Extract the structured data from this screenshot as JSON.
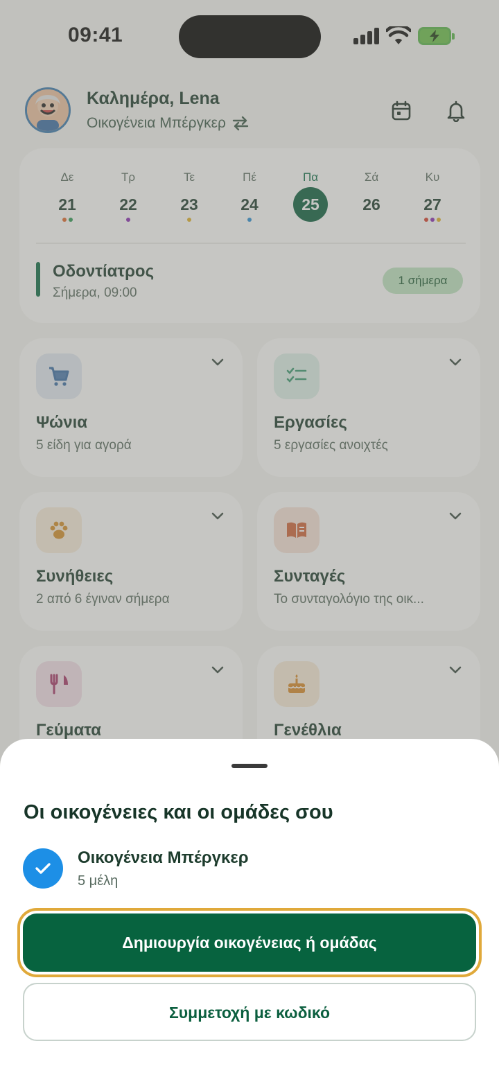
{
  "status_bar": {
    "time": "09:41"
  },
  "header": {
    "greeting": "Καλημέρα, Lena",
    "family": "Οικογένεια Μπέργκερ",
    "icons": [
      "avatar",
      "swap-icon",
      "calendar-icon",
      "bell-icon"
    ]
  },
  "calendar": {
    "days": [
      {
        "name": "Δε",
        "date": "21",
        "dots": [
          "#e06a2e",
          "#2e9a55"
        ]
      },
      {
        "name": "Τρ",
        "date": "22",
        "dots": [
          "#8a2bb5"
        ]
      },
      {
        "name": "Τε",
        "date": "23",
        "dots": [
          "#e2b12a"
        ]
      },
      {
        "name": "Πέ",
        "date": "24",
        "dots": [
          "#2a8fd6"
        ]
      },
      {
        "name": "Πα",
        "date": "25",
        "dots": [
          "#0b6b45"
        ],
        "today": true
      },
      {
        "name": "Σά",
        "date": "26",
        "dots": []
      },
      {
        "name": "Κυ",
        "date": "27",
        "dots": [
          "#d8402f",
          "#8a2bb5",
          "#e2b12a"
        ]
      }
    ],
    "event": {
      "title": "Οδοντίατρος",
      "time": "Σήμερα, 09:00",
      "badge": "1 σήμερα"
    }
  },
  "tiles": [
    {
      "title": "Ψώνια",
      "subtitle": "5 είδη για αγορά",
      "icon": "cart-icon",
      "color": "#3b6fa8",
      "bg": "#e3ebf4"
    },
    {
      "title": "Εργασίες",
      "subtitle": "5 εργασίες ανοιχτές",
      "icon": "checklist-icon",
      "color": "#3a9a72",
      "bg": "#dff1ea"
    },
    {
      "title": "Συνήθειες",
      "subtitle": "2 από 6 έγιναν σήμερα",
      "icon": "paw-icon",
      "color": "#d6902a",
      "bg": "#faeedd"
    },
    {
      "title": "Συνταγές",
      "subtitle": "Το συνταγολόγιο της οικ...",
      "icon": "book-icon",
      "color": "#d0653a",
      "bg": "#f9e4da"
    },
    {
      "title": "Γεύματα",
      "subtitle": "",
      "icon": "utensils-icon",
      "color": "#a8376a",
      "bg": "#f5e0ea"
    },
    {
      "title": "Γενέθλια",
      "subtitle": "",
      "icon": "cake-icon",
      "color": "#d98a2a",
      "bg": "#faecd9"
    }
  ],
  "sheet": {
    "title": "Οι οικογένειες και οι ομάδες σου",
    "family": {
      "name": "Οικογένεια Μπέργκερ",
      "members": "5 μέλη"
    },
    "primary_button": "Δημιουργία οικογένειας ή ομάδας",
    "secondary_button": "Συμμετοχή με κωδικό",
    "accent": "#07633f",
    "focus_ring": "#e0a93a"
  }
}
